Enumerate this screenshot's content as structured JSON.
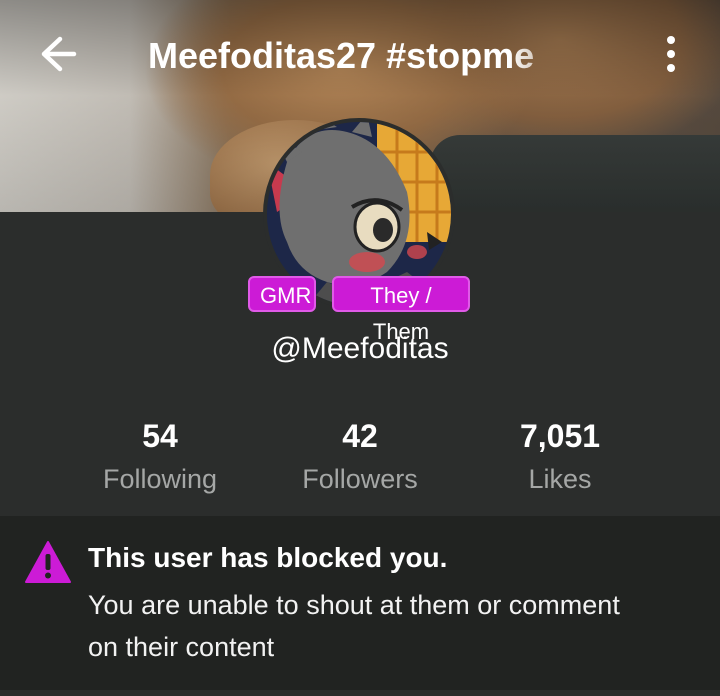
{
  "header": {
    "title": "Meefoditas27 #stopme",
    "back_icon": "arrow-left-icon",
    "menu_icon": "more-vertical-icon"
  },
  "profile": {
    "username": "@Meefoditas",
    "tags": [
      "GMR",
      "They / Them"
    ],
    "tag_color": "#cc1bd6"
  },
  "stats": [
    {
      "value": "54",
      "label": "Following"
    },
    {
      "value": "42",
      "label": "Followers"
    },
    {
      "value": "7,051",
      "label": "Likes"
    }
  ],
  "notice": {
    "icon": "warning-triangle-icon",
    "icon_color": "#cc1bd6",
    "title": "This user has blocked you.",
    "body": "You are unable to shout at them or comment on their content"
  }
}
